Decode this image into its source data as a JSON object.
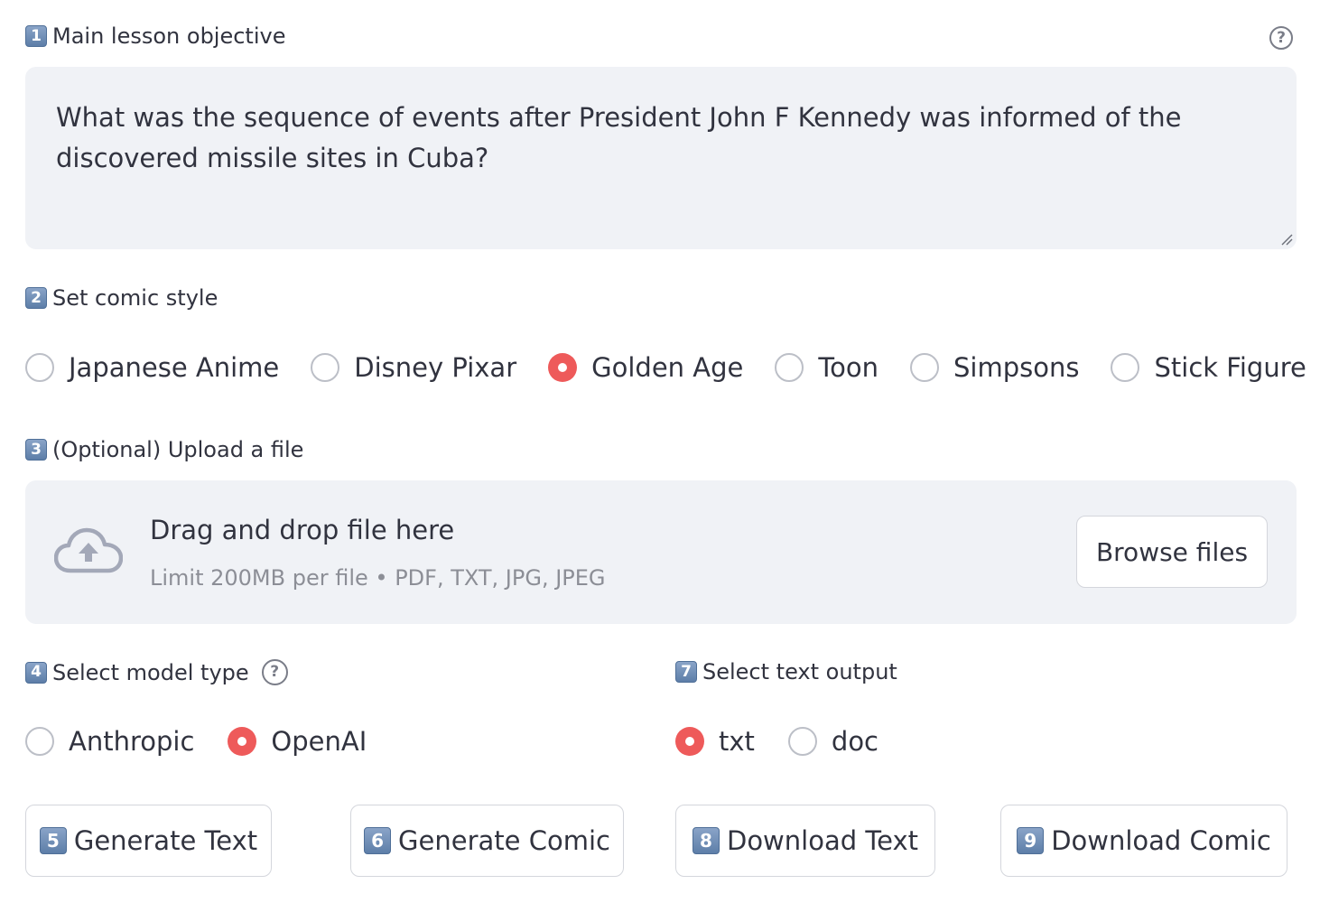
{
  "objective": {
    "badge": "1",
    "label": "Main lesson objective",
    "value": "What was the sequence of events after President John F Kennedy was informed of the discovered missile sites in Cuba?"
  },
  "comic_style": {
    "badge": "2",
    "label": "Set comic style",
    "options": [
      "Japanese Anime",
      "Disney Pixar",
      "Golden Age",
      "Toon",
      "Simpsons",
      "Stick Figure"
    ],
    "selected": "Golden Age"
  },
  "upload": {
    "badge": "3",
    "label": "(Optional) Upload a file",
    "title": "Drag and drop file here",
    "subtitle": "Limit 200MB per file • PDF, TXT, JPG, JPEG",
    "browse_label": "Browse files",
    "icon": "cloud-upload-icon"
  },
  "model_type": {
    "badge": "4",
    "label": "Select model type",
    "options": [
      "Anthropic",
      "OpenAI"
    ],
    "selected": "OpenAI"
  },
  "text_output": {
    "badge": "7",
    "label": "Select text output",
    "options": [
      "txt",
      "doc"
    ],
    "selected": "txt"
  },
  "buttons": {
    "generate_text": {
      "badge": "5",
      "label": "Generate Text"
    },
    "generate_comic": {
      "badge": "6",
      "label": "Generate Comic"
    },
    "download_text": {
      "badge": "8",
      "label": "Download Text"
    },
    "download_comic": {
      "badge": "9",
      "label": "Download Comic"
    }
  },
  "help_glyph": "?",
  "colors": {
    "accent": "#ee5a5a",
    "input_bg": "#f0f2f6",
    "text": "#31333f",
    "muted": "#8c8e96"
  }
}
